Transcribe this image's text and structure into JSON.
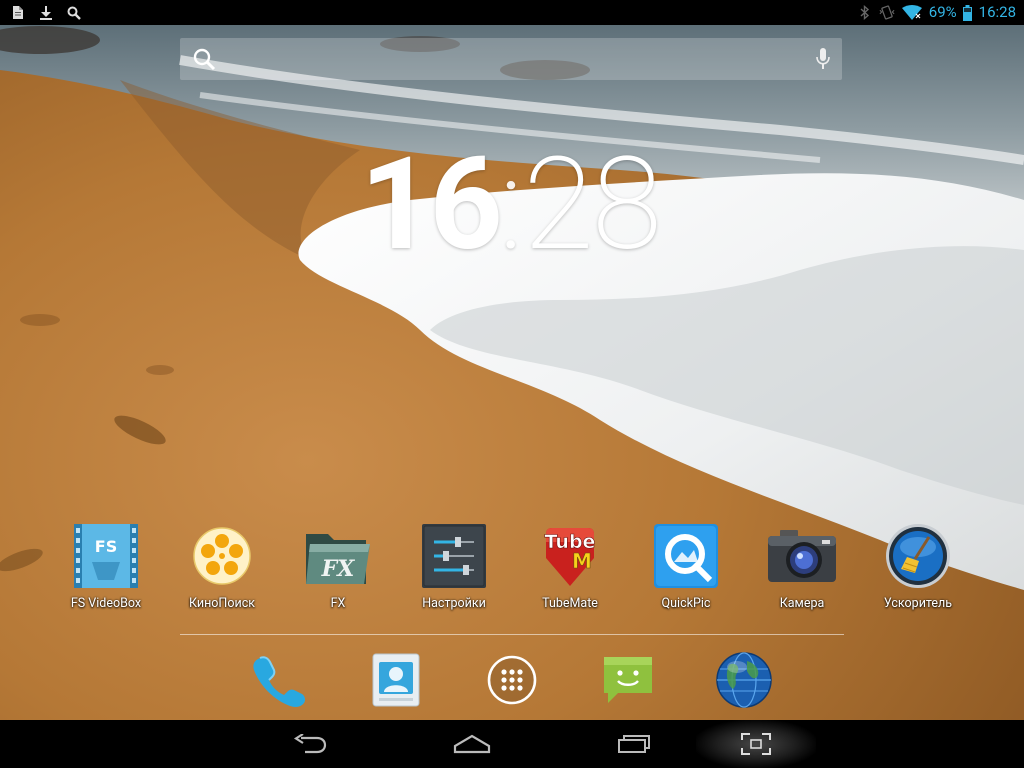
{
  "status_bar": {
    "left_icons": [
      "document-icon",
      "download-icon",
      "search-icon"
    ],
    "right_icons": [
      "bluetooth-icon",
      "vibrate-icon",
      "wifi-icon",
      "battery-icon"
    ],
    "battery": "69%",
    "time": "16:28"
  },
  "search_bar": {
    "search_icon": "search-icon",
    "mic_icon": "microphone-icon"
  },
  "clock_widget": {
    "hours": "16",
    "separator": ":",
    "minutes": "28"
  },
  "apps": [
    {
      "label": "FS VideoBox",
      "icon": "fs-videobox-icon"
    },
    {
      "label": "КиноПоиск",
      "icon": "kinopoisk-icon"
    },
    {
      "label": "FX",
      "icon": "fx-file-explorer-icon"
    },
    {
      "label": "Настройки",
      "icon": "settings-icon"
    },
    {
      "label": "TubeMate",
      "icon": "tubemate-icon"
    },
    {
      "label": "QuickPic",
      "icon": "quickpic-icon"
    },
    {
      "label": "Камера",
      "icon": "camera-icon"
    },
    {
      "label": "Ускоритель",
      "icon": "booster-icon"
    }
  ],
  "fs_icon_text": "FS",
  "fx_icon_text": "FX",
  "tubemate_text": {
    "top": "Tube",
    "bottom": "M"
  },
  "dock": [
    {
      "name": "phone",
      "icon": "phone-icon"
    },
    {
      "name": "contacts",
      "icon": "contacts-icon"
    },
    {
      "name": "all-apps",
      "icon": "all-apps-icon"
    },
    {
      "name": "messaging",
      "icon": "messaging-icon"
    },
    {
      "name": "browser",
      "icon": "browser-globe-icon"
    }
  ],
  "nav_bar": [
    "back-icon",
    "home-icon",
    "recents-icon",
    "screenshot-icon"
  ],
  "colors": {
    "status_accent": "#33b5e5",
    "status_bar_bg": "#000000",
    "nav_bar_bg": "#000000",
    "label_text": "#ffffff"
  }
}
